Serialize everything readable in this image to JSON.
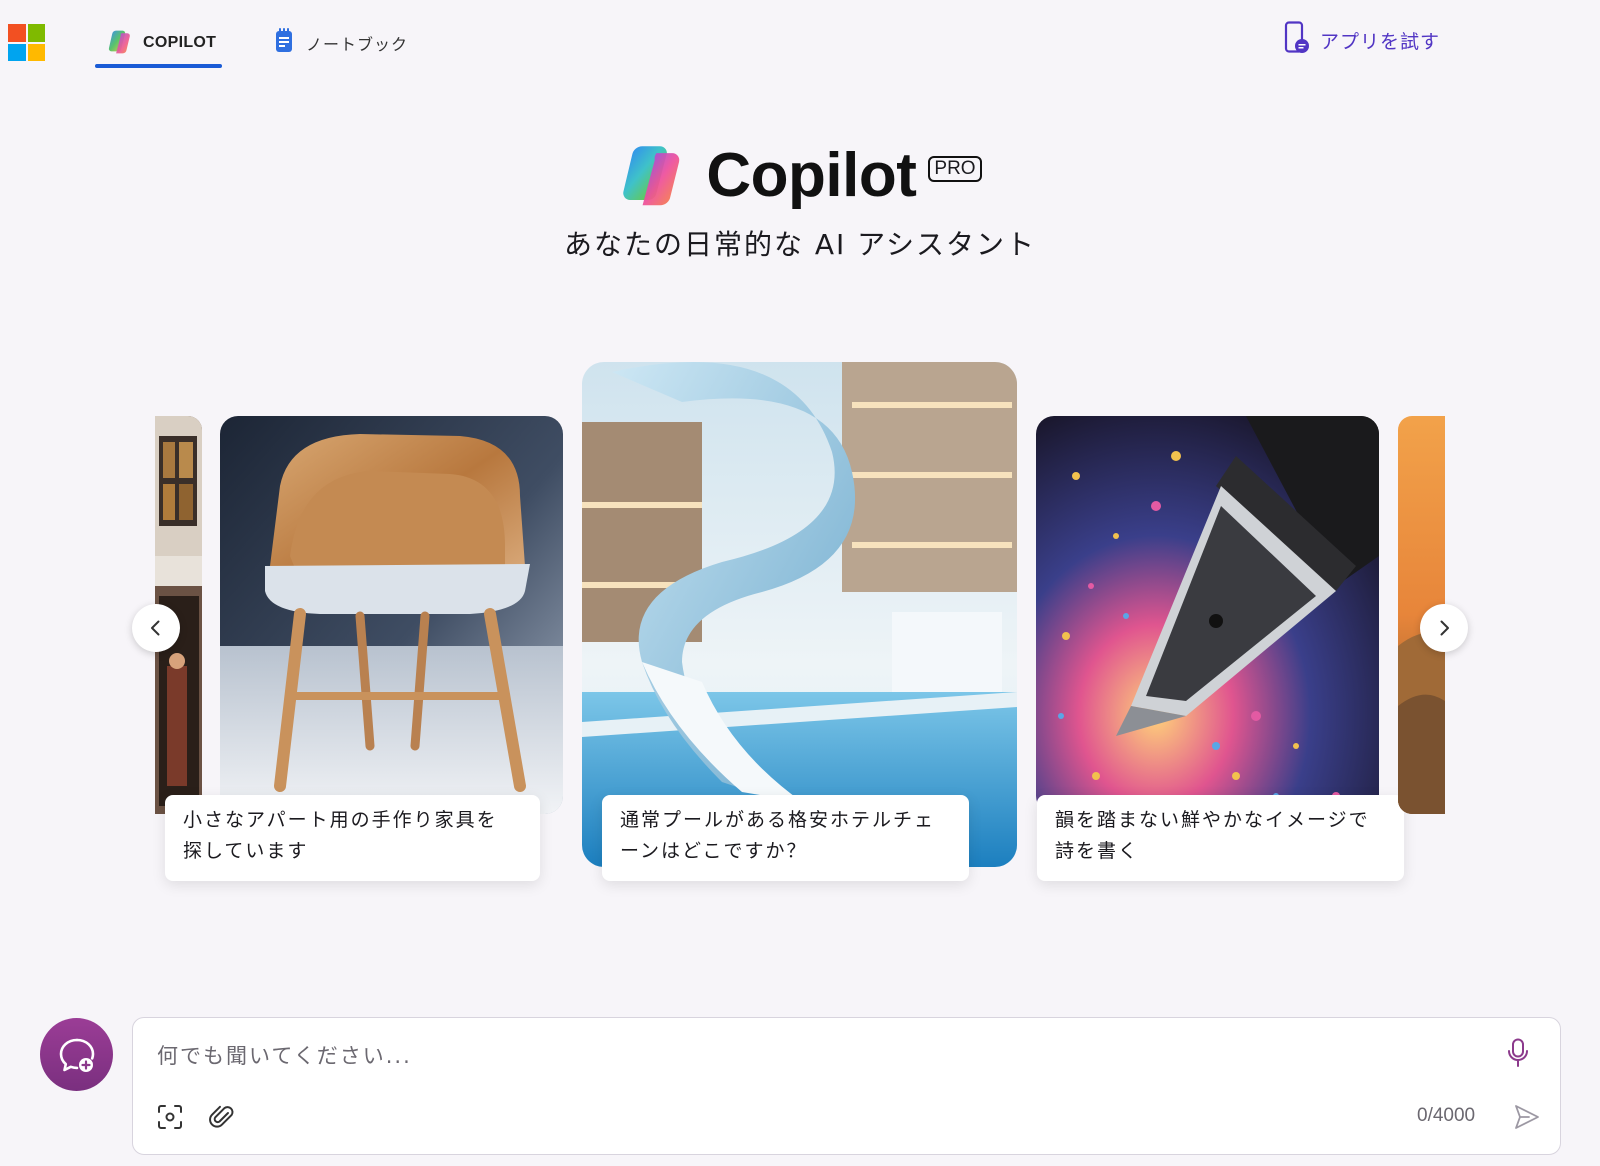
{
  "nav": {
    "tabs": [
      {
        "label": "COPILOT",
        "icon": "copilot-logo-icon",
        "active": true
      },
      {
        "label": "ノートブック",
        "icon": "notebook-icon",
        "active": false
      }
    ],
    "try_app_label": "アプリを試す",
    "accent_color": "#1a5bd6"
  },
  "hero": {
    "brand": "Copilot",
    "badge": "PRO",
    "tagline": "あなたの日常的な AI アシスタント"
  },
  "carousel": {
    "cards": [
      {
        "caption": "小さなアパート用の手作り家具を探しています",
        "caption_lines": [
          "小さなアパート用の手作り家具を",
          "探しています"
        ]
      },
      {
        "caption": "通常プールがある格安ホテルチェーンはどこですか？",
        "caption_lines": [
          "通常プールがある格安ホテルチェ",
          "ーンはどこですか？"
        ]
      },
      {
        "caption": "韻を踏まない鮮やかなイメージで詩を書く",
        "caption_lines": [
          "韻を踏まない鮮やかなイメージで",
          "詩を書く"
        ]
      }
    ],
    "prev_icon": "chevron-left-icon",
    "next_icon": "chevron-right-icon"
  },
  "composer": {
    "placeholder": "何でも聞いてください...",
    "value": "",
    "char_count": "0/4000",
    "new_chat_color": "#8c3a8c"
  }
}
